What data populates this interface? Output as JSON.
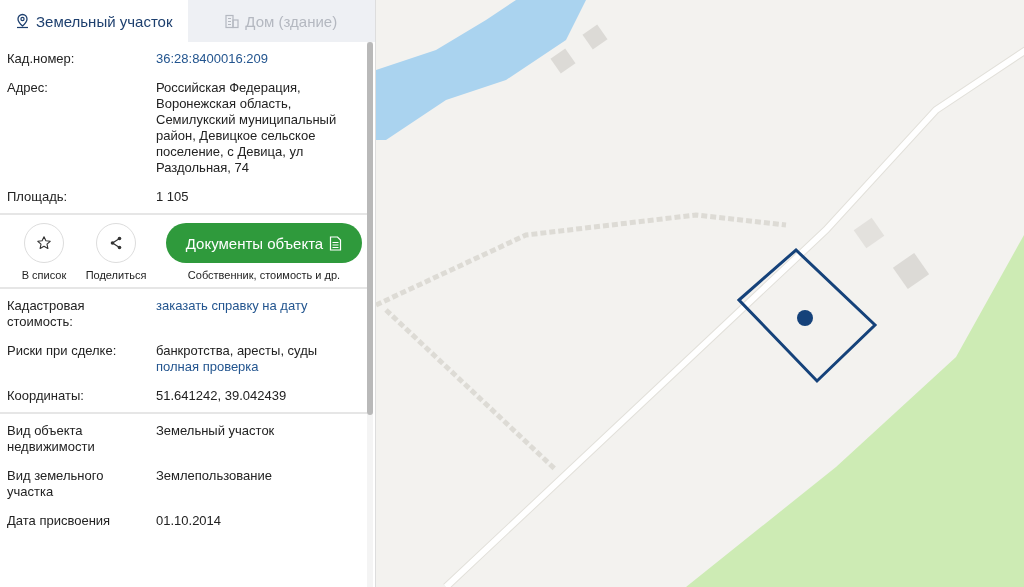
{
  "tabs": [
    {
      "label": "Земельный участок",
      "selected": true
    },
    {
      "label": "Дом (здание)",
      "selected": false
    }
  ],
  "details_top": [
    {
      "label": "Кад.номер:",
      "values": [
        {
          "text": "36:28:8400016:209",
          "kind": "link"
        }
      ]
    },
    {
      "label": "Адрес:",
      "values": [
        {
          "text": "Российская Федерация, Воронежская область, Семилукский муниципальный район, Девицкое сельское поселение, с Девица, ул Раздольная, 74",
          "kind": "text"
        }
      ]
    },
    {
      "label": "Площадь:",
      "values": [
        {
          "text": "1 105",
          "kind": "text"
        }
      ]
    }
  ],
  "actions": [
    {
      "label": "В список"
    },
    {
      "label": "Поделиться"
    }
  ],
  "documents_button": {
    "label": "Документы объекта",
    "caption": "Собственник, стоимость и др."
  },
  "details_middle": [
    {
      "label": "Кадастровая стоимость:",
      "values": [
        {
          "text": "заказать справку на дату",
          "kind": "link"
        }
      ]
    },
    {
      "label": "Риски при сделке:",
      "values": [
        {
          "text": "банкротства, аресты, суды",
          "kind": "text"
        },
        {
          "text": "полная проверка",
          "kind": "link"
        }
      ]
    },
    {
      "label": "Координаты:",
      "values": [
        {
          "text": "51.641242, 39.042439",
          "kind": "text"
        }
      ]
    }
  ],
  "details_bottom": [
    {
      "label": "Вид объекта недвижимости",
      "values": [
        {
          "text": "Земельный участок",
          "kind": "text"
        }
      ]
    },
    {
      "label": "Вид земельного участка",
      "values": [
        {
          "text": "Землепользование",
          "kind": "text"
        }
      ]
    },
    {
      "label": "Дата присвоения",
      "values": [
        {
          "text": "01.10.2014",
          "kind": "text"
        }
      ]
    }
  ]
}
